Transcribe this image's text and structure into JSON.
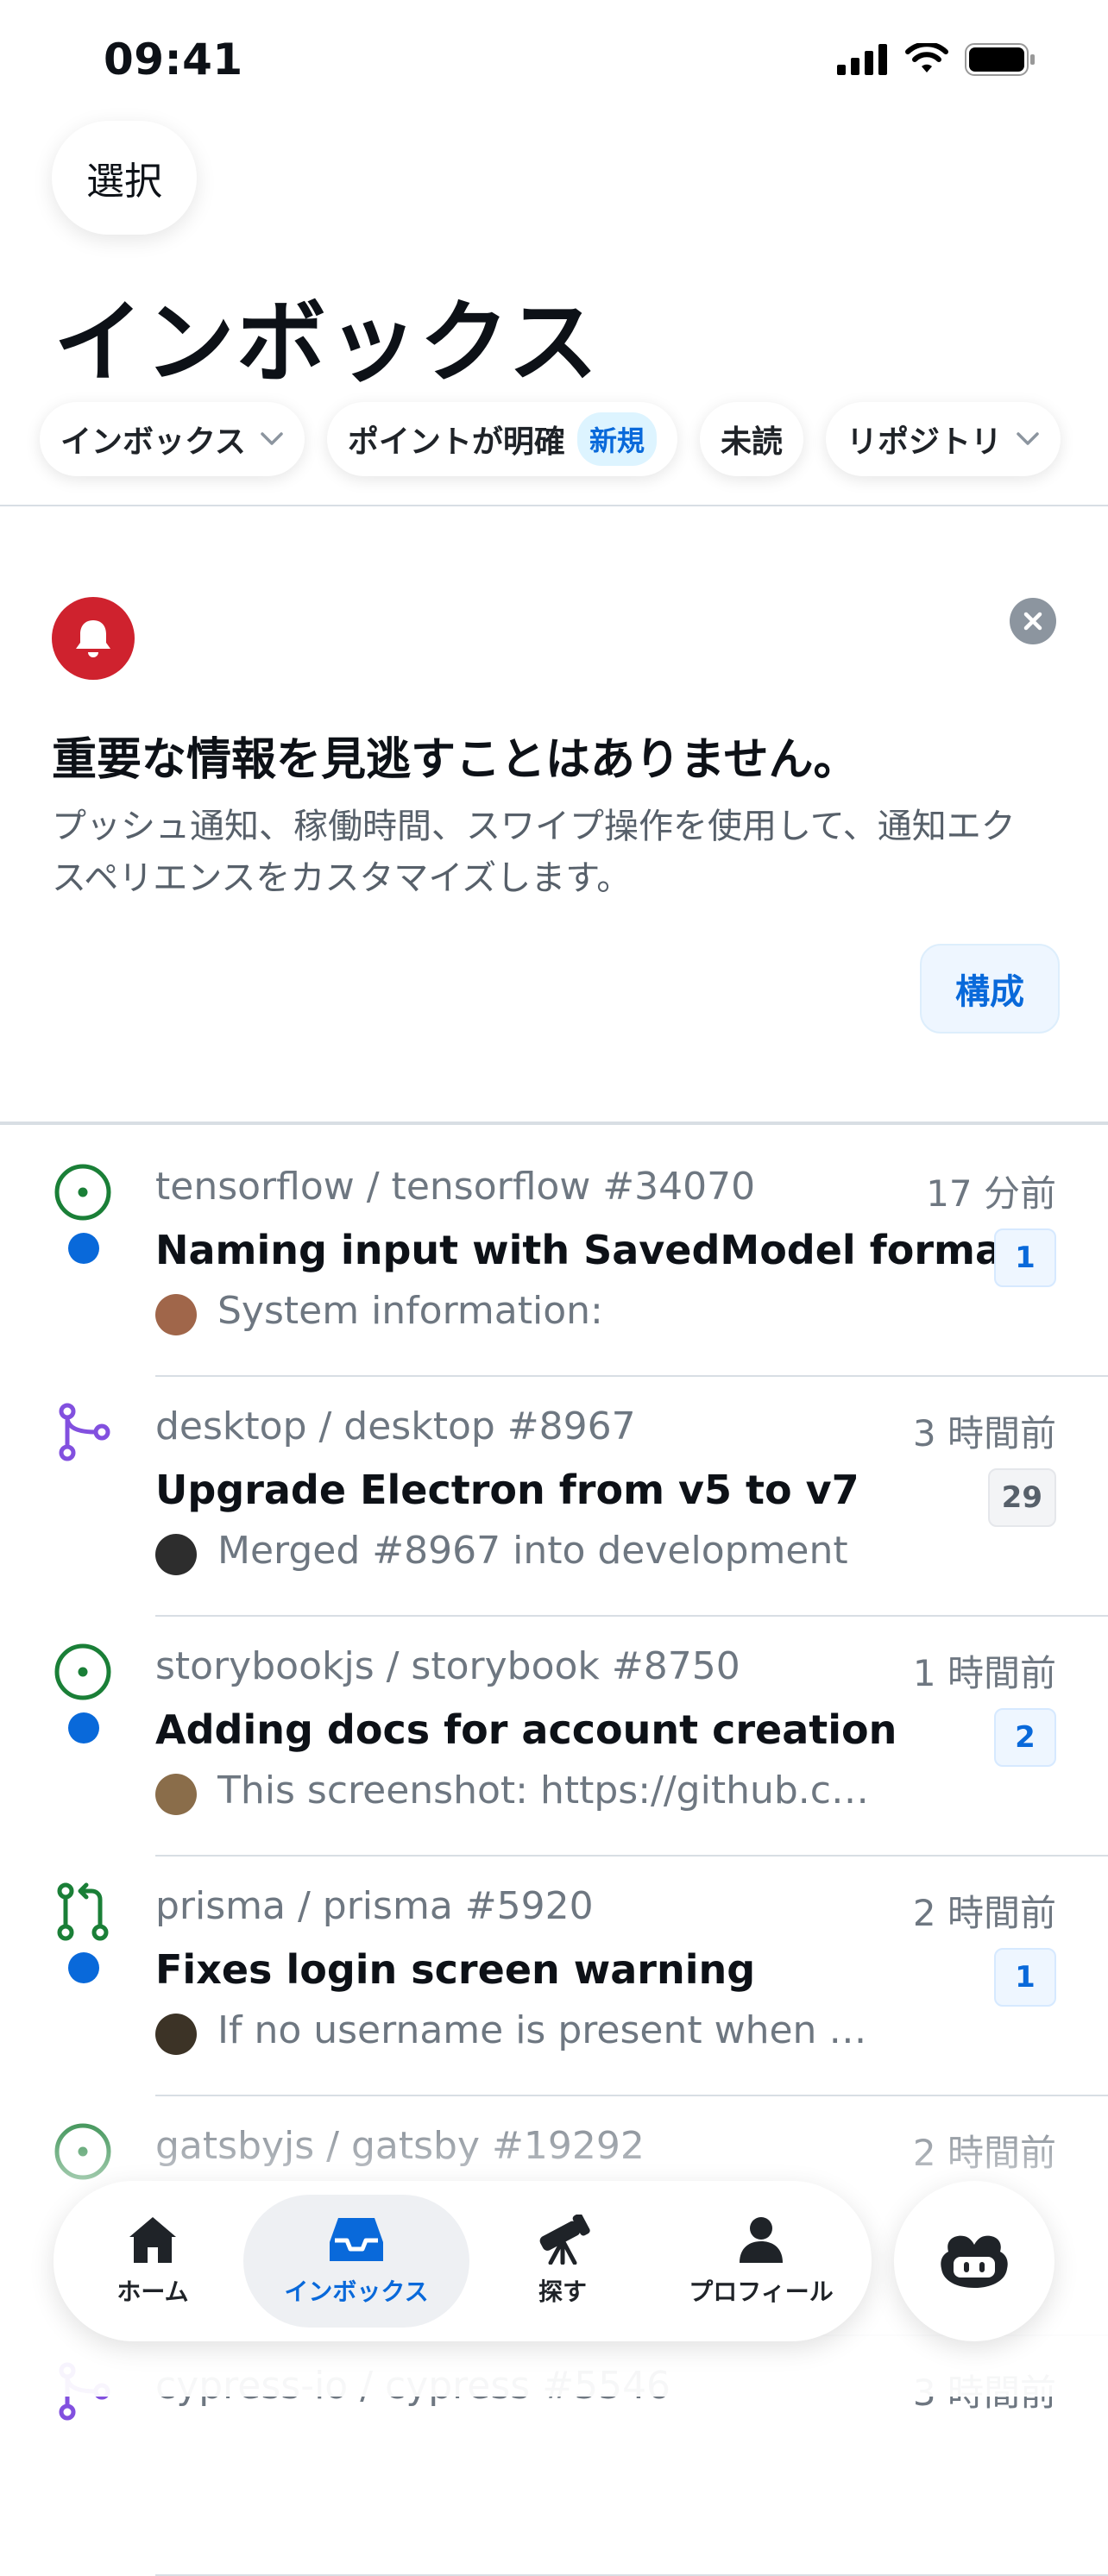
{
  "status_bar": {
    "time": "09:41"
  },
  "header": {
    "select_label": "選択",
    "title": "インボックス"
  },
  "filters": {
    "inbox_label": "インボックス",
    "focused_label": "ポイントが明確",
    "new_badge": "新規",
    "unread_label": "未読",
    "repository_label": "リポジトリ"
  },
  "promo": {
    "title": "重要な情報を見逃すことはありません。",
    "body": "プッシュ通知、稼働時間、スワイプ操作を使用して、通知エクスペリエンスをカスタマイズします。",
    "configure_label": "構成"
  },
  "notifications": [
    {
      "icon": "issue-open-icon",
      "unread": true,
      "repo": "tensorflow / tensorflow #34070",
      "time": "17 分前",
      "title": "Naming input with SavedModel format",
      "preview": "System information:",
      "count": "1"
    },
    {
      "icon": "merged-pr-icon",
      "unread": false,
      "repo": "desktop / desktop #8967",
      "time": "3 時間前",
      "title": "Upgrade Electron from v5 to v7",
      "preview": "Merged #8967 into development",
      "count": "29"
    },
    {
      "icon": "issue-open-icon",
      "unread": true,
      "repo": "storybookjs / storybook #8750",
      "time": "1 時間前",
      "title": "Adding docs for account creation",
      "preview": "This screenshot: https://github.co...",
      "count": "2"
    },
    {
      "icon": "pull-request-icon",
      "unread": true,
      "repo": "prisma / prisma #5920",
      "time": "2 時間前",
      "title": "Fixes login screen warning",
      "preview": "If no username is present when a...",
      "count": "1"
    },
    {
      "icon": "issue-open-icon",
      "unread": false,
      "repo": "gatsbyjs / gatsby #19292",
      "time": "2 時間前",
      "title": "",
      "preview": "",
      "count": ""
    },
    {
      "icon": "merged-pr-icon",
      "unread": false,
      "repo": "cypress-io / cypress #5546",
      "time": "3 時間前",
      "title": "",
      "preview": "",
      "count": ""
    }
  ],
  "tab_bar": {
    "home": "ホーム",
    "inbox": "インボックス",
    "explore": "探す",
    "profile": "プロフィール"
  },
  "colors": {
    "accent": "#0969da",
    "open": "#1a7f37",
    "merged": "#8250df",
    "bell": "#cf222e"
  }
}
